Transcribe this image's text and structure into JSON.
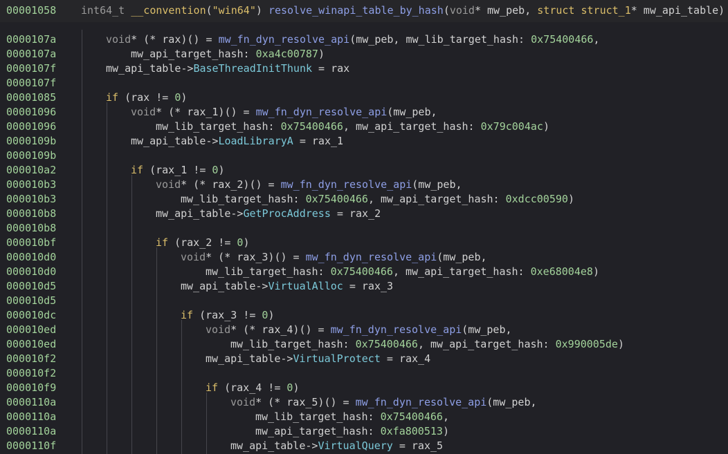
{
  "header": {
    "address": "00001058",
    "tokens": [
      {
        "t": "int64_t ",
        "c": "type"
      },
      {
        "t": "__convention",
        "c": "kw"
      },
      {
        "t": "(",
        "c": "punc"
      },
      {
        "t": "\"win64\"",
        "c": "str"
      },
      {
        "t": ") ",
        "c": "punc"
      },
      {
        "t": "resolve_winapi_table_by_hash",
        "c": "fn"
      },
      {
        "t": "(",
        "c": "punc"
      },
      {
        "t": "void",
        "c": "type"
      },
      {
        "t": "* mw_peb, ",
        "c": "var"
      },
      {
        "t": "struct ",
        "c": "kw"
      },
      {
        "t": "struct_1",
        "c": "kw"
      },
      {
        "t": "* mw_api_table)",
        "c": "var"
      }
    ]
  },
  "lines": [
    {
      "addr": "0000107a",
      "indent": 1,
      "tokens": [
        {
          "t": "void",
          "c": "type"
        },
        {
          "t": "* (* rax)() = ",
          "c": "var"
        },
        {
          "t": "mw_fn_dyn_resolve_api",
          "c": "fn"
        },
        {
          "t": "(mw_peb, mw_lib_target_hash: ",
          "c": "var"
        },
        {
          "t": "0x75400466",
          "c": "num"
        },
        {
          "t": ",",
          "c": "punc"
        }
      ]
    },
    {
      "addr": "0000107a",
      "indent": 2,
      "tokens": [
        {
          "t": "mw_api_target_hash: ",
          "c": "var"
        },
        {
          "t": "0xa4c00787",
          "c": "num"
        },
        {
          "t": ")",
          "c": "punc"
        }
      ]
    },
    {
      "addr": "0000107f",
      "indent": 1,
      "tokens": [
        {
          "t": "mw_api_table->",
          "c": "var"
        },
        {
          "t": "BaseThreadInitThunk",
          "c": "field"
        },
        {
          "t": " = rax",
          "c": "var"
        }
      ]
    },
    {
      "addr": "0000107f",
      "indent": 0,
      "tokens": []
    },
    {
      "addr": "00001085",
      "indent": 1,
      "tokens": [
        {
          "t": "if",
          "c": "kw"
        },
        {
          "t": " (rax != ",
          "c": "var"
        },
        {
          "t": "0",
          "c": "num"
        },
        {
          "t": ")",
          "c": "punc"
        }
      ]
    },
    {
      "addr": "00001096",
      "indent": 2,
      "tokens": [
        {
          "t": "void",
          "c": "type"
        },
        {
          "t": "* (* rax_1)() = ",
          "c": "var"
        },
        {
          "t": "mw_fn_dyn_resolve_api",
          "c": "fn"
        },
        {
          "t": "(mw_peb,",
          "c": "var"
        }
      ]
    },
    {
      "addr": "00001096",
      "indent": 3,
      "tokens": [
        {
          "t": "mw_lib_target_hash: ",
          "c": "var"
        },
        {
          "t": "0x75400466",
          "c": "num"
        },
        {
          "t": ", mw_api_target_hash: ",
          "c": "var"
        },
        {
          "t": "0x79c004ac",
          "c": "num"
        },
        {
          "t": ")",
          "c": "punc"
        }
      ]
    },
    {
      "addr": "0000109b",
      "indent": 2,
      "tokens": [
        {
          "t": "mw_api_table->",
          "c": "var"
        },
        {
          "t": "LoadLibraryA",
          "c": "field"
        },
        {
          "t": " = rax_1",
          "c": "var"
        }
      ]
    },
    {
      "addr": "0000109b",
      "indent": 0,
      "tokens": []
    },
    {
      "addr": "000010a2",
      "indent": 2,
      "tokens": [
        {
          "t": "if",
          "c": "kw"
        },
        {
          "t": " (rax_1 != ",
          "c": "var"
        },
        {
          "t": "0",
          "c": "num"
        },
        {
          "t": ")",
          "c": "punc"
        }
      ]
    },
    {
      "addr": "000010b3",
      "indent": 3,
      "tokens": [
        {
          "t": "void",
          "c": "type"
        },
        {
          "t": "* (* rax_2)() = ",
          "c": "var"
        },
        {
          "t": "mw_fn_dyn_resolve_api",
          "c": "fn"
        },
        {
          "t": "(mw_peb,",
          "c": "var"
        }
      ]
    },
    {
      "addr": "000010b3",
      "indent": 4,
      "tokens": [
        {
          "t": "mw_lib_target_hash: ",
          "c": "var"
        },
        {
          "t": "0x75400466",
          "c": "num"
        },
        {
          "t": ", mw_api_target_hash: ",
          "c": "var"
        },
        {
          "t": "0xdcc00590",
          "c": "num"
        },
        {
          "t": ")",
          "c": "punc"
        }
      ]
    },
    {
      "addr": "000010b8",
      "indent": 3,
      "tokens": [
        {
          "t": "mw_api_table->",
          "c": "var"
        },
        {
          "t": "GetProcAddress",
          "c": "field"
        },
        {
          "t": " = rax_2",
          "c": "var"
        }
      ]
    },
    {
      "addr": "000010b8",
      "indent": 0,
      "tokens": []
    },
    {
      "addr": "000010bf",
      "indent": 3,
      "tokens": [
        {
          "t": "if",
          "c": "kw"
        },
        {
          "t": " (rax_2 != ",
          "c": "var"
        },
        {
          "t": "0",
          "c": "num"
        },
        {
          "t": ")",
          "c": "punc"
        }
      ]
    },
    {
      "addr": "000010d0",
      "indent": 4,
      "tokens": [
        {
          "t": "void",
          "c": "type"
        },
        {
          "t": "* (* rax_3)() = ",
          "c": "var"
        },
        {
          "t": "mw_fn_dyn_resolve_api",
          "c": "fn"
        },
        {
          "t": "(mw_peb,",
          "c": "var"
        }
      ]
    },
    {
      "addr": "000010d0",
      "indent": 5,
      "tokens": [
        {
          "t": "mw_lib_target_hash: ",
          "c": "var"
        },
        {
          "t": "0x75400466",
          "c": "num"
        },
        {
          "t": ", mw_api_target_hash: ",
          "c": "var"
        },
        {
          "t": "0xe68004e8",
          "c": "num"
        },
        {
          "t": ")",
          "c": "punc"
        }
      ]
    },
    {
      "addr": "000010d5",
      "indent": 4,
      "tokens": [
        {
          "t": "mw_api_table->",
          "c": "var"
        },
        {
          "t": "VirtualAlloc",
          "c": "field"
        },
        {
          "t": " = rax_3",
          "c": "var"
        }
      ]
    },
    {
      "addr": "000010d5",
      "indent": 0,
      "tokens": []
    },
    {
      "addr": "000010dc",
      "indent": 4,
      "tokens": [
        {
          "t": "if",
          "c": "kw"
        },
        {
          "t": " (rax_3 != ",
          "c": "var"
        },
        {
          "t": "0",
          "c": "num"
        },
        {
          "t": ")",
          "c": "punc"
        }
      ]
    },
    {
      "addr": "000010ed",
      "indent": 5,
      "tokens": [
        {
          "t": "void",
          "c": "type"
        },
        {
          "t": "* (* rax_4)() = ",
          "c": "var"
        },
        {
          "t": "mw_fn_dyn_resolve_api",
          "c": "fn"
        },
        {
          "t": "(mw_peb,",
          "c": "var"
        }
      ]
    },
    {
      "addr": "000010ed",
      "indent": 6,
      "tokens": [
        {
          "t": "mw_lib_target_hash: ",
          "c": "var"
        },
        {
          "t": "0x75400466",
          "c": "num"
        },
        {
          "t": ", mw_api_target_hash: ",
          "c": "var"
        },
        {
          "t": "0x990005de",
          "c": "num"
        },
        {
          "t": ")",
          "c": "punc"
        }
      ]
    },
    {
      "addr": "000010f2",
      "indent": 5,
      "tokens": [
        {
          "t": "mw_api_table->",
          "c": "var"
        },
        {
          "t": "VirtualProtect",
          "c": "field"
        },
        {
          "t": " = rax_4",
          "c": "var"
        }
      ]
    },
    {
      "addr": "000010f2",
      "indent": 0,
      "tokens": []
    },
    {
      "addr": "000010f9",
      "indent": 5,
      "tokens": [
        {
          "t": "if",
          "c": "kw"
        },
        {
          "t": " (rax_4 != ",
          "c": "var"
        },
        {
          "t": "0",
          "c": "num"
        },
        {
          "t": ")",
          "c": "punc"
        }
      ]
    },
    {
      "addr": "0000110a",
      "indent": 6,
      "tokens": [
        {
          "t": "void",
          "c": "type"
        },
        {
          "t": "* (* rax_5)() = ",
          "c": "var"
        },
        {
          "t": "mw_fn_dyn_resolve_api",
          "c": "fn"
        },
        {
          "t": "(mw_peb,",
          "c": "var"
        }
      ]
    },
    {
      "addr": "0000110a",
      "indent": 7,
      "tokens": [
        {
          "t": "mw_lib_target_hash: ",
          "c": "var"
        },
        {
          "t": "0x75400466",
          "c": "num"
        },
        {
          "t": ",",
          "c": "punc"
        }
      ]
    },
    {
      "addr": "0000110a",
      "indent": 7,
      "tokens": [
        {
          "t": "mw_api_target_hash: ",
          "c": "var"
        },
        {
          "t": "0xfa800513",
          "c": "num"
        },
        {
          "t": ")",
          "c": "punc"
        }
      ]
    },
    {
      "addr": "0000110f",
      "indent": 6,
      "tokens": [
        {
          "t": "mw_api_table->",
          "c": "var"
        },
        {
          "t": "VirtualQuery",
          "c": "field"
        },
        {
          "t": " = rax_5",
          "c": "var"
        }
      ]
    }
  ],
  "colors": {
    "background": "#212126",
    "header_background": "#262629",
    "address": "#a3d39b",
    "keyword": "#dbbe6a",
    "type": "#9a9a9a",
    "function": "#8e9fe6",
    "field": "#7cc9d9",
    "number": "#a3d39b",
    "text": "#d2d2d2",
    "guide": "#46464c"
  }
}
